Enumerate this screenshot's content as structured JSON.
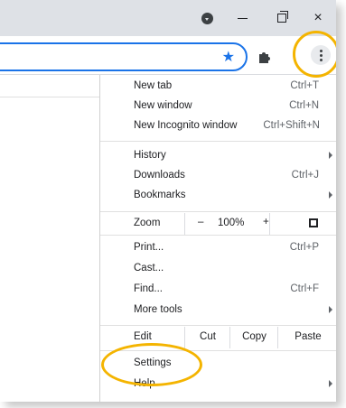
{
  "window": {
    "profile_icon": "profile-icon",
    "minimize_icon": "minimize-icon",
    "maximize_icon": "maximize-icon",
    "close_label": "×"
  },
  "toolbar": {
    "bookmark_star": "★",
    "extensions_icon": "puzzle-icon",
    "menu_icon": "kebab-menu-icon"
  },
  "menu": {
    "group1": [
      {
        "label": "New tab",
        "shortcut": "Ctrl+T"
      },
      {
        "label": "New window",
        "shortcut": "Ctrl+N"
      },
      {
        "label": "New Incognito window",
        "shortcut": "Ctrl+Shift+N"
      }
    ],
    "group2": [
      {
        "label": "History",
        "submenu": true
      },
      {
        "label": "Downloads",
        "shortcut": "Ctrl+J"
      },
      {
        "label": "Bookmarks",
        "submenu": true
      }
    ],
    "zoom": {
      "label": "Zoom",
      "minus": "–",
      "level": "100%",
      "plus": "+"
    },
    "group3": [
      {
        "label": "Print...",
        "shortcut": "Ctrl+P"
      },
      {
        "label": "Cast..."
      },
      {
        "label": "Find...",
        "shortcut": "Ctrl+F"
      },
      {
        "label": "More tools",
        "submenu": true
      }
    ],
    "edit": {
      "label": "Edit",
      "cut": "Cut",
      "copy": "Copy",
      "paste": "Paste"
    },
    "group4": [
      {
        "label": "Settings"
      },
      {
        "label": "Help",
        "submenu": true
      }
    ]
  },
  "colors": {
    "highlight": "#f4b400",
    "accent": "#1a73e8",
    "titlebar": "#dee1e6"
  }
}
